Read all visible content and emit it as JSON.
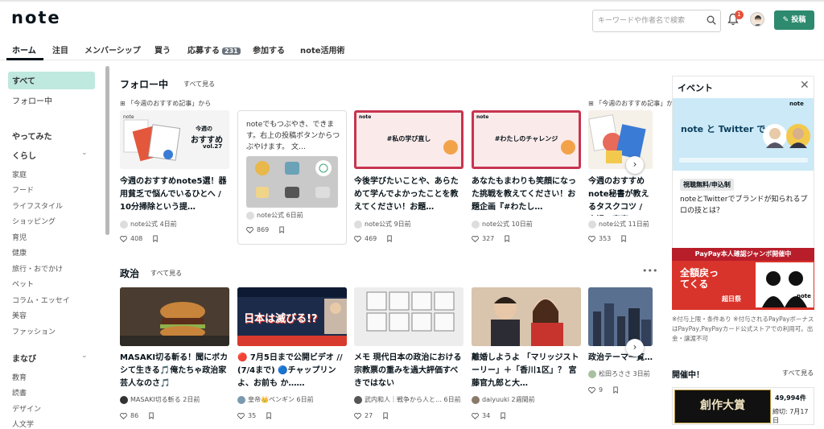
{
  "header": {
    "logo": "note",
    "search_placeholder": "キーワードや作者名で検索",
    "notification_count": "1",
    "post_button": "投稿"
  },
  "tabs": [
    {
      "label": "ホーム"
    },
    {
      "label": "注目"
    },
    {
      "label": "メンバーシップ"
    },
    {
      "label": "買う"
    },
    {
      "label": "応募する",
      "count": "231"
    },
    {
      "label": "参加する"
    },
    {
      "label": "note活用術"
    }
  ],
  "sidebar": {
    "all": "すべて",
    "following": "フォロー中",
    "tried": "やってみた",
    "life": "くらし",
    "life_items": [
      "家庭",
      "フード",
      "ライフスタイル",
      "ショッピング",
      "育児",
      "健康",
      "旅行・おでかけ",
      "ペット",
      "コラム・エッセイ",
      "美容",
      "ファッション"
    ],
    "learn": "まなび",
    "learn_items": [
      "教育",
      "読書",
      "デザイン",
      "人文学"
    ]
  },
  "follow_section": {
    "title": "フォロー中",
    "see_all": "すべて見る",
    "source": "「今週のおすすめ記事」から",
    "cards": [
      {
        "title": "今週のおすすめnote5選！器用貧乏で悩んでいるひとへ / 10分掃除という提…",
        "author": "note公式",
        "time": "4日前",
        "likes": "408",
        "thumb_big": "今週の",
        "thumb_big2": "おすすめ",
        "thumb_vol": "vol.27"
      },
      {
        "text": "noteでもつぶやき、できます。右上の投稿ボタンからつぶやけます。 文…",
        "author": "note公式",
        "time": "6日前",
        "likes": "869"
      },
      {
        "title": "今後学びたいことや、あらためて学んでよかったことを教えてください！お題…",
        "author": "note公式",
        "time": "9日前",
        "likes": "469",
        "thumb_tag": "#私の学び直し"
      },
      {
        "title": "あなたもまわりも笑顔になった挑戦を教えてください！お題企画『#わたし…",
        "author": "note公式",
        "time": "10日前",
        "likes": "327",
        "thumb_tag": "#わたしのチャレンジ"
      },
      {
        "title": "今週のおすすめnote秘書が教えるタスクコツ / 夫婦の家事…",
        "author": "note公式",
        "time": "11日前",
        "likes": "353"
      }
    ]
  },
  "politics_section": {
    "title": "政治",
    "see_all": "すべて見る",
    "cards": [
      {
        "title": "MASAKI切る斬る！聞にボカシて生きる🎵俺たちゃ政治家芸人なのさ🎵",
        "author": "MASAKI切る斬る",
        "time": "2日前",
        "likes": "86"
      },
      {
        "title": "🔴 7月5日まで公開ビデオ // (7/4まで) 🔵チャップリンよ、お前も か……",
        "author": "皇帝👑ペンギン",
        "time": "6日前",
        "likes": "35",
        "thumb_text": "日本は滅びる!?"
      },
      {
        "title": "メモ 現代日本の政治における宗教票の重みを過大評価すべきではない",
        "author": "武内和人｜戦争から人と…",
        "time": "6日前",
        "likes": "27"
      },
      {
        "title": "離婚しようよ 「マリッジストーリー」＋「香川1区」？ 宮藤官九郎と大…",
        "author": "daiyuuki",
        "time": "2週間前",
        "likes": "34"
      },
      {
        "title": "政治テーマ一覧…",
        "author": "松田ろささ",
        "time": "3日前",
        "likes": "9"
      }
    ]
  },
  "event_panel": {
    "title": "イベント",
    "banner_logo": "note",
    "banner_title": "note と Twitter で",
    "tag": "視聴無料/申込制",
    "desc": "noteとTwitterでブランドが知られるプロの技とは？"
  },
  "paypay": {
    "headline": "PayPay本人確認ジャンボ開催中",
    "big": "全額戻ってくる",
    "brand": "note",
    "fest": "超日祭",
    "note": "※付与上限・条件あり ※付与されるPayPayボーナスはPayPay,PayPayカード公式ストアでの利用可。出金・譲渡不可"
  },
  "ongoing": {
    "title": "開催中！",
    "see_all": "すべて見る",
    "contest": "創作大賞",
    "count": "49,994件",
    "deadline": "締切: 7月17日"
  },
  "colors": {
    "accent": "#2d8a6e",
    "selected": "#bfe8df",
    "badge": "#e5533d",
    "paypay": "#d9342b",
    "twitter_banner": "#cbe9f6"
  }
}
